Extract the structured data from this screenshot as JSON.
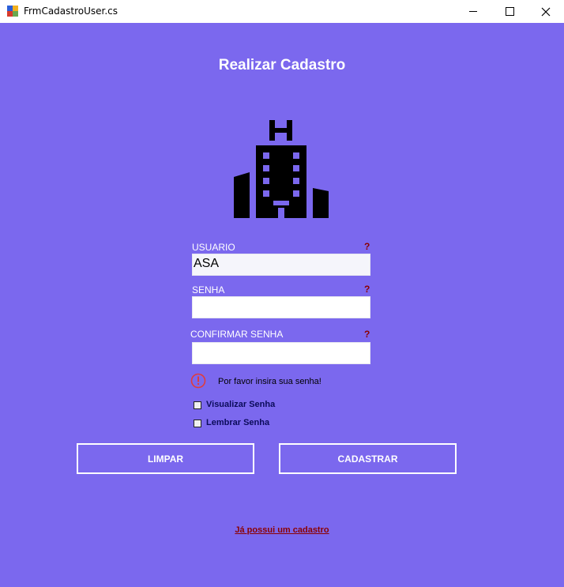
{
  "window": {
    "title": "FrmCadastroUser.cs"
  },
  "form": {
    "heading": "Realizar Cadastro",
    "logo_icon": "hotel-building-icon",
    "usuario": {
      "label": "USUARIO",
      "value": "ASA",
      "help": "?"
    },
    "senha": {
      "label": "SENHA",
      "value": "",
      "help": "?"
    },
    "confirmar": {
      "label": "CONFIRMAR SENHA",
      "value": "",
      "help": "?"
    },
    "error": {
      "icon": "error-icon",
      "message": "Por favor insira sua senha!"
    },
    "show_password": {
      "label": "Visualizar Senha",
      "checked": false
    },
    "remember_password": {
      "label": "Lembrar Senha",
      "checked": false
    },
    "clear_button": "LIMPAR",
    "register_button": "CADASTRAR",
    "login_link": "Já possui um cadastro"
  },
  "colors": {
    "background": "#7b68ee",
    "help": "#8b0000",
    "error": "#e03c3c"
  }
}
